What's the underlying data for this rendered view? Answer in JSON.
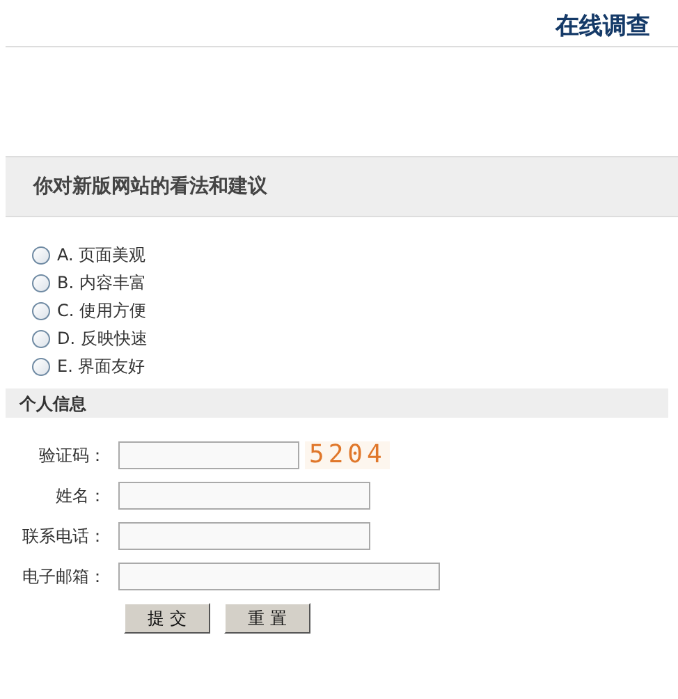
{
  "header": {
    "title": "在线调查"
  },
  "survey": {
    "question": "你对新版网站的看法和建议",
    "options": [
      {
        "label": "A. 页面美观",
        "selected": false
      },
      {
        "label": "B. 内容丰富",
        "selected": false
      },
      {
        "label": "C. 使用方便",
        "selected": false
      },
      {
        "label": "D. 反映快速",
        "selected": false
      },
      {
        "label": "E. 界面友好",
        "selected": false
      }
    ]
  },
  "personal_info": {
    "title": "个人信息",
    "fields": [
      {
        "label": "验证码：",
        "kind": "captcha",
        "captcha": "5204"
      },
      {
        "label": "姓名：",
        "kind": "text"
      },
      {
        "label": "联系电话：",
        "kind": "text"
      },
      {
        "label": "电子邮箱：",
        "kind": "wide"
      }
    ],
    "buttons": [
      "提 交",
      "重 置"
    ]
  }
}
